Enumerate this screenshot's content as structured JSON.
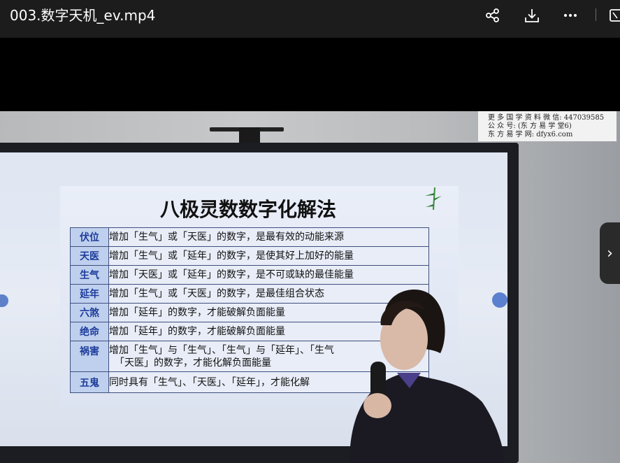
{
  "window": {
    "title": "003.数字天机_ev.mp4",
    "actions": [
      "share-icon",
      "download-icon",
      "more-icon",
      "sidebar-icon"
    ]
  },
  "video": {
    "watermark_lines": [
      "更 多 国 学 资 料 微 信: 447039585",
      "公 众 号: (东 方 易 学 堂6)",
      "东 方 易 学 网: dfyx6.com"
    ],
    "slide": {
      "title": "八极灵数数字化解法",
      "rows": [
        {
          "name": "伏位",
          "desc": "增加「生气」或「天医」的数字，是最有效的动能来源"
        },
        {
          "name": "天医",
          "desc": "增加「生气」或「延年」的数字，是使其好上加好的能量"
        },
        {
          "name": "生气",
          "desc": "增加「天医」或「延年」的数字，是不可或缺的最佳能量"
        },
        {
          "name": "延年",
          "desc": "增加「生气」或「天医」的数字，是最佳组合状态"
        },
        {
          "name": "六煞",
          "desc": "增加「延年」的数字，才能破解负面能量"
        },
        {
          "name": "绝命",
          "desc": "增加「延年」的数字，才能破解负面能量"
        },
        {
          "name": "祸害",
          "desc": "增加「生气」与「生气」、「生气」与「延年」、「生气",
          "desc2": "「天医」的数字，才能化解负面能量"
        },
        {
          "name": "五鬼",
          "desc": "同时具有「生气」、「天医」、「延年」，才能化解"
        }
      ]
    }
  },
  "player": {
    "next_label": "›"
  }
}
